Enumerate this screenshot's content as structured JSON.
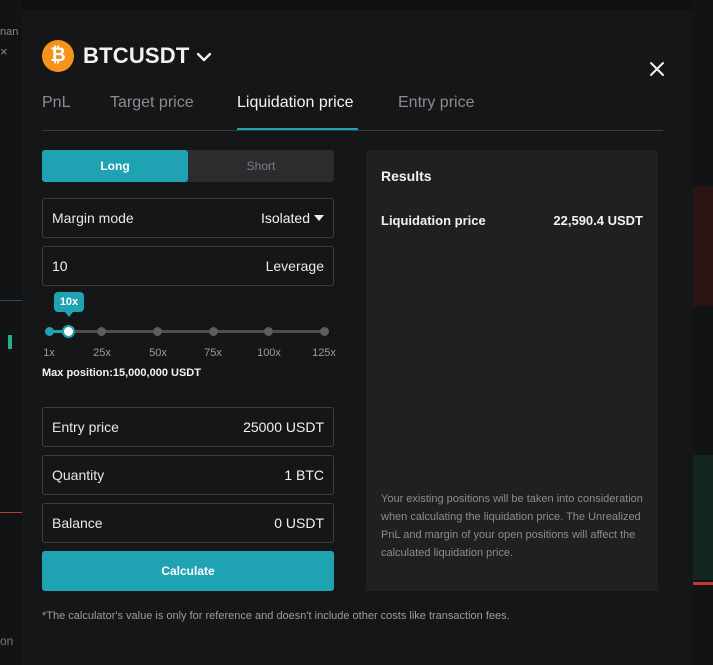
{
  "background": {
    "left_fragment_top": "nan",
    "left_fragment_icon": "×",
    "left_fragment_bottom": "on"
  },
  "header": {
    "coin_icon": "bitcoin-icon",
    "coin_symbol": "₿",
    "pair": "BTCUSDT",
    "close_label": "close"
  },
  "tabs": [
    {
      "label": "PnL",
      "active": false
    },
    {
      "label": "Target price",
      "active": false
    },
    {
      "label": "Liquidation price",
      "active": true
    },
    {
      "label": "Entry price",
      "active": false
    }
  ],
  "side": {
    "long_label": "Long",
    "short_label": "Short",
    "selected": "Long"
  },
  "margin_mode": {
    "label": "Margin mode",
    "value": "Isolated"
  },
  "leverage": {
    "value": "10",
    "label": "Leverage",
    "tooltip": "10x",
    "ticks": [
      "1x",
      "25x",
      "50x",
      "75x",
      "100x",
      "125x"
    ]
  },
  "max_position": "Max position:15,000,000 USDT",
  "entry_price": {
    "label": "Entry price",
    "value": "25000 USDT"
  },
  "quantity": {
    "label": "Quantity",
    "value": "1 BTC"
  },
  "balance": {
    "label": "Balance",
    "value": "0 USDT"
  },
  "calculate_label": "Calculate",
  "disclaimer": "*The calculator's value is only for reference and doesn't include other costs like transaction fees.",
  "results": {
    "title": "Results",
    "liq_label": "Liquidation price",
    "liq_value": "22,590.4 USDT",
    "note": "Your existing positions will be taken into consideration when calculating the liquidation price. The Unrealized PnL and margin of your open positions will affect the calculated liquidation price."
  },
  "colors": {
    "accent": "#1fa3b3",
    "bitcoin": "#f7931a",
    "modal_bg": "#151617",
    "panel_bg": "#1f2021"
  }
}
